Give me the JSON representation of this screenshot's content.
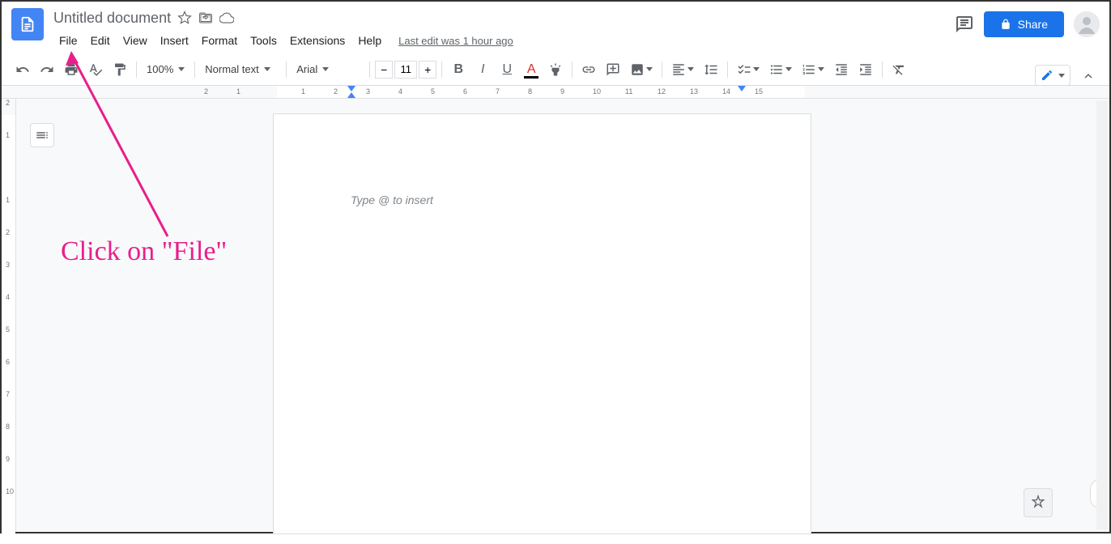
{
  "header": {
    "title": "Untitled document",
    "last_edit": "Last edit was 1 hour ago",
    "share_label": "Share"
  },
  "menu": {
    "items": [
      "File",
      "Edit",
      "View",
      "Insert",
      "Format",
      "Tools",
      "Extensions",
      "Help"
    ]
  },
  "toolbar": {
    "zoom": "100%",
    "style": "Normal text",
    "font": "Arial",
    "font_size": "11"
  },
  "document": {
    "placeholder": "Type @ to insert"
  },
  "ruler_h_numbers": [
    "2",
    "1",
    "1",
    "2",
    "3",
    "4",
    "5",
    "6",
    "7",
    "8",
    "9",
    "10",
    "11",
    "12",
    "13",
    "14",
    "15"
  ],
  "ruler_v_numbers": [
    "2",
    "1",
    "1",
    "2",
    "3",
    "4",
    "5",
    "6",
    "7",
    "8",
    "9",
    "10"
  ],
  "annotation": {
    "text": "Click on \"File\""
  }
}
